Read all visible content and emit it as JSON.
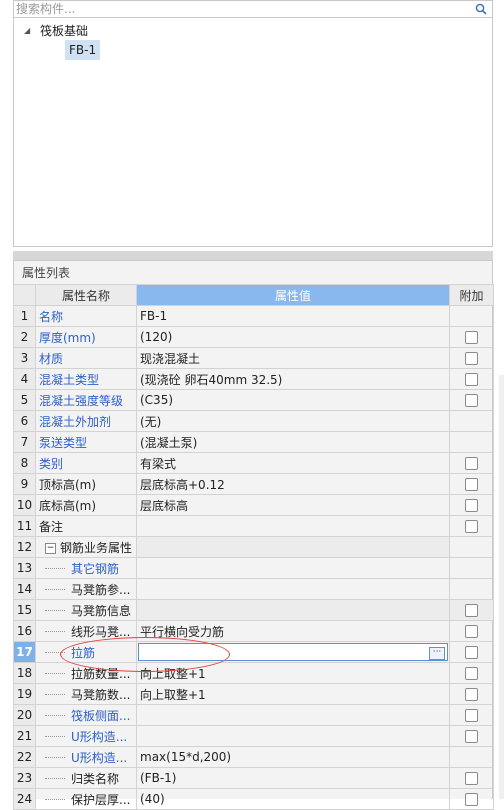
{
  "search": {
    "placeholder": "搜索构件..."
  },
  "tree": {
    "root_label": "筏板基础",
    "child_label": "FB-1"
  },
  "panel": {
    "title": "属性列表"
  },
  "columns": {
    "name": "属性名称",
    "value": "属性值",
    "extra": "附加"
  },
  "rows": [
    {
      "idx": "1",
      "name": "名称",
      "value": "FB-1",
      "blue": true,
      "cb": false
    },
    {
      "idx": "2",
      "name": "厚度(mm)",
      "value": "(120)",
      "blue": true,
      "cb": true
    },
    {
      "idx": "3",
      "name": "材质",
      "value": "现浇混凝土",
      "blue": true,
      "cb": true
    },
    {
      "idx": "4",
      "name": "混凝土类型",
      "value": "(现浇砼 卵石40mm 32.5)",
      "blue": true,
      "cb": true
    },
    {
      "idx": "5",
      "name": "混凝土强度等级",
      "value": "(C35)",
      "blue": true,
      "cb": true
    },
    {
      "idx": "6",
      "name": "混凝土外加剂",
      "value": "(无)",
      "blue": true,
      "cb": false
    },
    {
      "idx": "7",
      "name": "泵送类型",
      "value": "(混凝土泵)",
      "blue": true,
      "cb": false
    },
    {
      "idx": "8",
      "name": "类别",
      "value": "有梁式",
      "blue": true,
      "cb": true
    },
    {
      "idx": "9",
      "name": "顶标高(m)",
      "value": "层底标高+0.12",
      "blue": false,
      "cb": true
    },
    {
      "idx": "10",
      "name": "底标高(m)",
      "value": "层底标高",
      "blue": false,
      "cb": true
    },
    {
      "idx": "11",
      "name": "备注",
      "value": "",
      "blue": false,
      "cb": true
    },
    {
      "idx": "12",
      "name": "钢筋业务属性",
      "value": "",
      "blue": false,
      "cb": false,
      "group": true
    },
    {
      "idx": "13",
      "name": "其它钢筋",
      "value": "",
      "blue": true,
      "cb": false,
      "child": true
    },
    {
      "idx": "14",
      "name": "马凳筋参...",
      "value": "",
      "blue": false,
      "cb": false,
      "child": true
    },
    {
      "idx": "15",
      "name": "马凳筋信息",
      "value": "",
      "blue": false,
      "cb": true,
      "child": true,
      "gray": true
    },
    {
      "idx": "16",
      "name": "线形马凳...",
      "value": "平行横向受力筋",
      "blue": false,
      "cb": true,
      "child": true
    },
    {
      "idx": "17",
      "name": "拉筋",
      "value": "",
      "blue": true,
      "cb": true,
      "child": true,
      "selected": true
    },
    {
      "idx": "18",
      "name": "拉筋数量...",
      "value": "向上取整+1",
      "blue": false,
      "cb": true,
      "child": true
    },
    {
      "idx": "19",
      "name": "马凳筋数...",
      "value": "向上取整+1",
      "blue": false,
      "cb": true,
      "child": true
    },
    {
      "idx": "20",
      "name": "筏板侧面...",
      "value": "",
      "blue": true,
      "cb": true,
      "child": true
    },
    {
      "idx": "21",
      "name": "U形构造...",
      "value": "",
      "blue": true,
      "cb": true,
      "child": true
    },
    {
      "idx": "22",
      "name": "U形构造...",
      "value": "max(15*d,200)",
      "blue": true,
      "cb": false,
      "child": true
    },
    {
      "idx": "23",
      "name": "归类名称",
      "value": "(FB-1)",
      "blue": false,
      "cb": true,
      "child": true
    },
    {
      "idx": "24",
      "name": "保护层厚...",
      "value": "(40)",
      "blue": false,
      "cb": true,
      "child": true
    }
  ]
}
